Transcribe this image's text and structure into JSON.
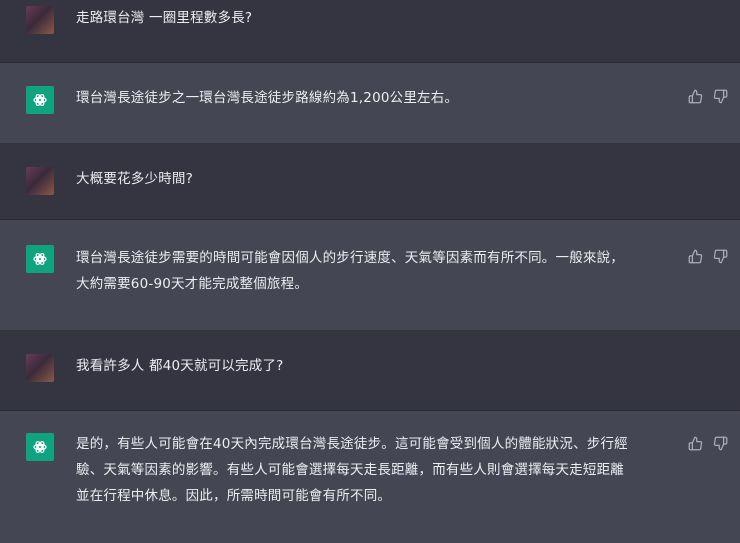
{
  "messages": [
    {
      "role": "user",
      "text": "走路環台灣 一圈里程數多長?"
    },
    {
      "role": "assistant",
      "text": "環台灣長途徒步之一環台灣長途徒步路線約為1,200公里左右。"
    },
    {
      "role": "user",
      "text": "大概要花多少時間?"
    },
    {
      "role": "assistant",
      "text": "環台灣長途徒步需要的時間可能會因個人的步行速度、天氣等因素而有所不同。一般來說，\n大約需要60-90天才能完成整個旅程。"
    },
    {
      "role": "user",
      "text": "我看許多人 都40天就可以完成了?"
    },
    {
      "role": "assistant",
      "text": "是的，有些人可能會在40天內完成環台灣長途徒步。這可能會受到個人的體能狀況、步行經\n驗、天氣等因素的影響。有些人可能會選擇每天走長距離，而有些人則會選擇每天走短距離\n並在行程中休息。因此，所需時間可能會有所不同。"
    }
  ],
  "icons": {
    "user_avatar": "user-avatar",
    "assistant_avatar": "openai-logo-icon",
    "thumbs_up": "thumbs-up-icon",
    "thumbs_down": "thumbs-down-icon"
  },
  "colors": {
    "user_bg": "#343541",
    "assistant_bg": "#444654",
    "text": "#ececf1",
    "icon": "#acacbe",
    "brand": "#10a37f"
  }
}
